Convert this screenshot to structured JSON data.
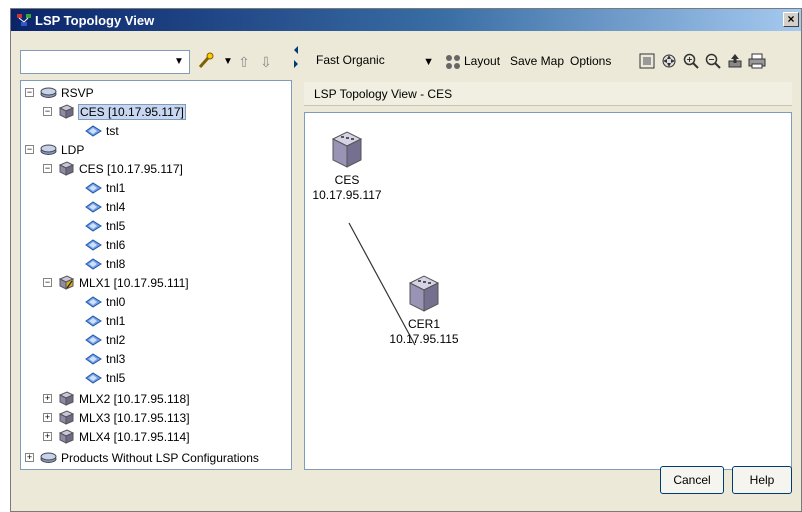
{
  "window": {
    "title": "LSP Topology View"
  },
  "left_toolbar": {
    "combo_value": ""
  },
  "tree": {
    "rsvp": {
      "label": "RSVP",
      "children": [
        {
          "label": "CES [10.17.95.117]",
          "tunnels": [
            "tst"
          ]
        }
      ]
    },
    "ldp": {
      "label": "LDP",
      "ces": {
        "label": "CES [10.17.95.117]",
        "tunnels": [
          "tnl1",
          "tnl4",
          "tnl5",
          "tnl6",
          "tnl8"
        ]
      },
      "mlx1": {
        "label": "MLX1 [10.17.95.111]",
        "tunnels": [
          "tnl0",
          "tnl1",
          "tnl2",
          "tnl3",
          "tnl5"
        ]
      },
      "mlx2": {
        "label": "MLX2 [10.17.95.118]"
      },
      "mlx3": {
        "label": "MLX3 [10.17.95.113]"
      },
      "mlx4": {
        "label": "MLX4 [10.17.95.114]"
      }
    },
    "products_without_lsp": {
      "label": "Products Without LSP Configurations"
    }
  },
  "right_toolbar": {
    "layout_selected": "Fast Organic",
    "layout_label": "Layout",
    "save_map_label": "Save Map",
    "options_label": "Options"
  },
  "view": {
    "header": "LSP Topology View - CES",
    "nodes": [
      {
        "name": "CES",
        "ip": "10.17.95.117"
      },
      {
        "name": "CER1",
        "ip": "10.17.95.115"
      }
    ]
  },
  "buttons": {
    "cancel": "Cancel",
    "help": "Help"
  },
  "icons": {
    "device": "router-device-icon",
    "tunnel": "tunnel-icon",
    "protocol": "protocol-disk-icon"
  }
}
